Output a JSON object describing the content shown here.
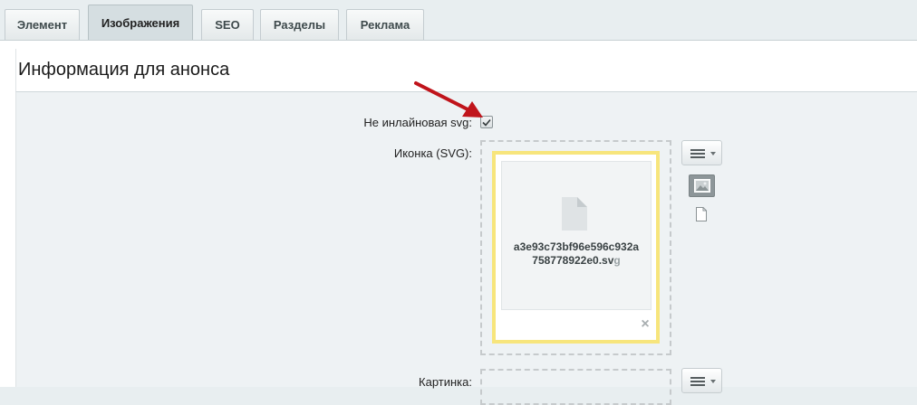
{
  "tabs": [
    {
      "label": "Элемент",
      "active": false
    },
    {
      "label": "Изображения",
      "active": true
    },
    {
      "label": "SEO",
      "active": false
    },
    {
      "label": "Разделы",
      "active": false
    },
    {
      "label": "Реклама",
      "active": false
    }
  ],
  "section": {
    "title": "Информация для анонса"
  },
  "fields": {
    "non_inline_svg": {
      "label": "Не инлайновая svg:",
      "checked": true
    },
    "icon_svg": {
      "label": "Иконка (SVG):",
      "file_name_part1": "a3e93c73bf96e596c932a",
      "file_name_part2": "758778922e0.sv",
      "file_name_part3": "g"
    },
    "picture": {
      "label": "Картинка:"
    }
  },
  "icons": {
    "file": "file-icon",
    "remove": "close-icon",
    "menu": "hamburger-menu-icon",
    "image": "image-icon",
    "document": "document-icon",
    "annotation": "red-arrow-annotation"
  },
  "colors": {
    "annotation_arrow": "#c0141b",
    "file_card_border": "#f7e57c",
    "image_button": "#8d9699"
  }
}
